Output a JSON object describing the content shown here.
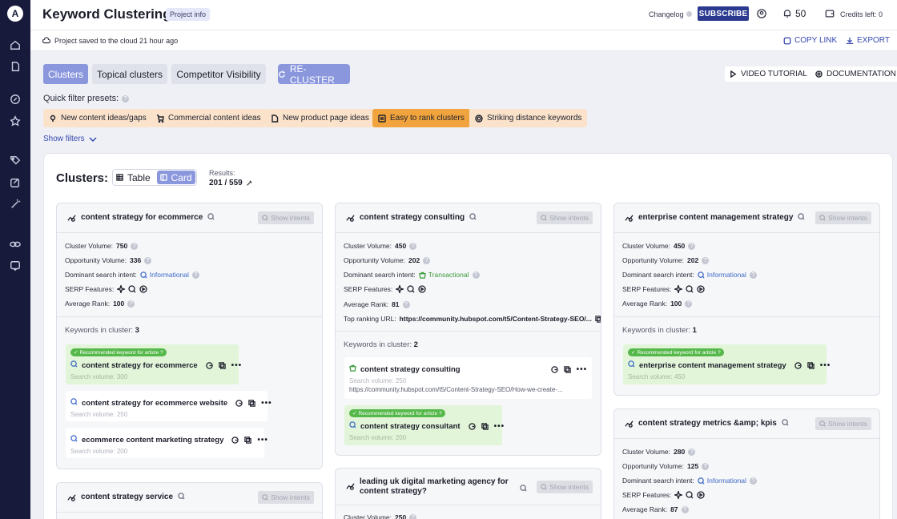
{
  "header": {
    "title": "Keyword Clustering",
    "project_info": "Project info",
    "changelog": "Changelog",
    "subscribe": "SUBSCRIBE",
    "notifications": "50",
    "credits": "Credits left: 0"
  },
  "savebar": {
    "saved": "Project saved to the cloud 21 hour ago",
    "copy_link": "COPY LINK",
    "export": "EXPORT"
  },
  "tabs": [
    {
      "label": "Clusters",
      "active": true
    },
    {
      "label": "Topical clusters",
      "active": false
    },
    {
      "label": "Competitor Visibility",
      "active": false
    }
  ],
  "recluster": "RE-CLUSTER",
  "video_tutorial": "VIDEO TUTORIAL",
  "documentation": "DOCUMENTATION",
  "quick_filter": {
    "label": "Quick filter presets:",
    "presets": [
      {
        "label": "New content ideas/gaps",
        "icon": "bulb-icon"
      },
      {
        "label": "Commercial content ideas",
        "icon": "cart-icon"
      },
      {
        "label": "New product page ideas",
        "icon": "page-icon"
      },
      {
        "label": "Easy to rank clusters",
        "icon": "list-icon",
        "active": true
      },
      {
        "label": "Striking distance keywords",
        "icon": "target-icon"
      }
    ],
    "show_filters": "Show filters"
  },
  "clusters_panel": {
    "title": "Clusters:",
    "view_table": "Table",
    "view_card": "Card",
    "results_label": "Results:",
    "results_value": "201 / 559"
  },
  "labels": {
    "cluster_volume": "Cluster Volume:",
    "opportunity_volume": "Opportunity Volume:",
    "dominant_intent": "Dominant search intent:",
    "serp_features": "SERP Features:",
    "average_rank": "Average Rank:",
    "top_url": "Top ranking URL:",
    "keywords_in_cluster": "Keywords in cluster:",
    "show_intents": "Show intents",
    "recommended": "Recommended keyword for article",
    "search_volume": "Search volume:"
  },
  "cards": [
    {
      "title": "content strategy for ecommerce",
      "cluster_volume": "750",
      "opportunity_volume": "336",
      "intent": "Informational",
      "average_rank": "100",
      "keywords_count": "3",
      "keywords": [
        {
          "name": "content strategy for ecommerce",
          "volume": "300",
          "recommended": true
        },
        {
          "name": "content strategy for ecommerce website",
          "volume": "250",
          "recommended": false
        },
        {
          "name": "ecommerce content marketing strategy",
          "volume": "200",
          "recommended": false
        }
      ]
    },
    {
      "title": "content strategy consulting",
      "cluster_volume": "450",
      "opportunity_volume": "202",
      "intent": "Transactional",
      "average_rank": "81",
      "top_url": "https://community.hubspot.com/t5/Content-Strategy-SEO/...",
      "keywords_count": "2",
      "keywords": [
        {
          "name": "content strategy consulting",
          "volume": "250",
          "url": "https://community.hubspot.com/t5/Content-Strategy-SEO/How-we-create-...",
          "recommended": false
        },
        {
          "name": "content strategy consultant",
          "volume": "200",
          "recommended": true
        }
      ]
    },
    {
      "title": "enterprise content management strategy",
      "cluster_volume": "450",
      "opportunity_volume": "202",
      "intent": "Informational",
      "average_rank": "100",
      "keywords_count": "1",
      "keywords": [
        {
          "name": "enterprise content management strategy",
          "volume": "450",
          "recommended": true
        }
      ]
    },
    {
      "title": "content strategy metrics &amp; kpis",
      "cluster_volume": "280",
      "opportunity_volume": "125",
      "intent": "Informational",
      "average_rank": "87"
    },
    {
      "title": "content strategy service"
    },
    {
      "title": "leading uk digital marketing agency for content strategy?",
      "cluster_volume": "250"
    }
  ],
  "colors": {
    "sidebar": "#171a3a",
    "accent": "#8b97dd",
    "subscribe": "#2b3a8f",
    "preset": "#fbe3cb",
    "preset_active": "#f1a43d",
    "recommended_bg": "#e2f5d9",
    "informational": "#3d6ac6",
    "transactional": "#3a9a3a"
  }
}
